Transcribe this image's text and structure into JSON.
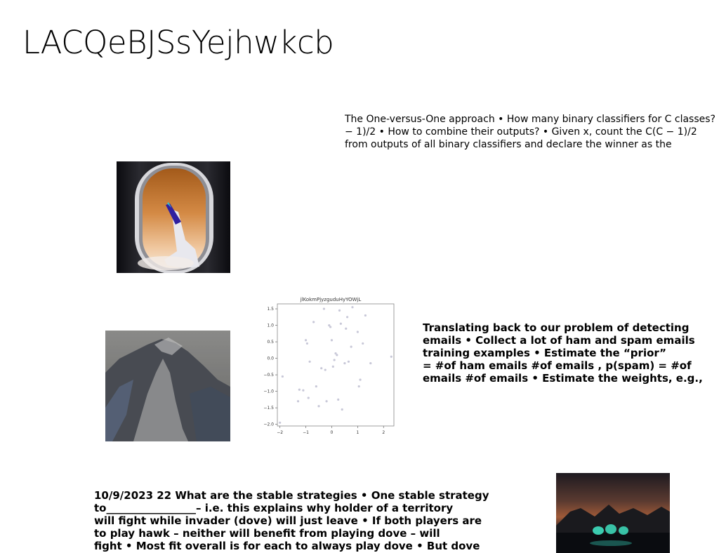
{
  "slide": {
    "title": "LACQeBJSsYejhwkcb",
    "text_blocks": [
      "The One-versus-One approach • How many binary classifiers for C classes?\n− 1)/2 • How to combine their outputs? • Given x, count the C(C − 1)/2\nfrom outputs of all binary classifiers and declare the winner as the",
      "Translating back to our problem of detecting\nemails • Collect a lot of ham and spam emails\ntraining examples • Estimate the “prior”\n= #of ham emails #of emails , p(spam) = #of\nemails #of emails • Estimate the weights, e.g.,",
      "10/9/2023 22 What are the stable strategies • One stable strategy\nto_________________– i.e. this explains why holder of a territory\nwill fight while invader (dove) will just leave • If both players are\nto play hawk – neither will benefit from playing dove – will\nfight • Most fit overall is for each to always play dove • But dove"
    ]
  },
  "images": {
    "window": "airplane-window-wing-photo",
    "mountain": "misty-mountain-peak-photo",
    "night": "night-lake-lights-photo"
  },
  "chart_data": {
    "type": "scatter",
    "title": "jlKokmPjyzguduHyYOWjL",
    "xlim": [
      -2.1,
      2.4
    ],
    "ylim": [
      -2.05,
      1.65
    ],
    "xticks": [
      -2,
      -1,
      0,
      1,
      2
    ],
    "yticks": [
      -2.0,
      -1.5,
      -1.0,
      -0.5,
      0.0,
      0.5,
      1.0,
      1.5
    ],
    "ytick_labels": [
      "−2.0",
      "−1.5",
      "−1.0",
      "−0.5",
      "0.0",
      "0.5",
      "1.0",
      "1.5"
    ],
    "xtick_labels": [
      "−2",
      "−1",
      "0",
      "1",
      "2"
    ],
    "grid": false,
    "point_color": "#c8c8d8",
    "points": [
      [
        -2.0,
        -1.95
      ],
      [
        -1.9,
        -0.55
      ],
      [
        -1.25,
        -0.95
      ],
      [
        -1.1,
        -0.97
      ],
      [
        -1.0,
        0.55
      ],
      [
        -0.95,
        0.45
      ],
      [
        -0.85,
        -0.1
      ],
      [
        -0.9,
        -1.2
      ],
      [
        -0.7,
        1.1
      ],
      [
        -0.6,
        -0.85
      ],
      [
        -0.5,
        -1.45
      ],
      [
        -0.3,
        1.5
      ],
      [
        -0.25,
        -0.35
      ],
      [
        -0.2,
        -1.3
      ],
      [
        -0.1,
        1.0
      ],
      [
        -0.05,
        0.95
      ],
      [
        0.0,
        0.55
      ],
      [
        0.05,
        -0.25
      ],
      [
        0.1,
        -0.05
      ],
      [
        0.2,
        0.1
      ],
      [
        0.25,
        -1.25
      ],
      [
        0.3,
        1.45
      ],
      [
        0.35,
        1.05
      ],
      [
        0.4,
        -1.55
      ],
      [
        0.5,
        -0.15
      ],
      [
        0.55,
        0.9
      ],
      [
        0.6,
        1.25
      ],
      [
        0.65,
        -0.1
      ],
      [
        0.75,
        0.35
      ],
      [
        0.8,
        1.55
      ],
      [
        1.0,
        0.8
      ],
      [
        1.05,
        -0.85
      ],
      [
        1.1,
        -0.65
      ],
      [
        1.2,
        0.45
      ],
      [
        1.3,
        1.3
      ],
      [
        1.5,
        -0.15
      ],
      [
        2.3,
        0.05
      ],
      [
        -1.3,
        -1.3
      ],
      [
        -0.4,
        -0.3
      ],
      [
        0.15,
        0.15
      ]
    ]
  }
}
